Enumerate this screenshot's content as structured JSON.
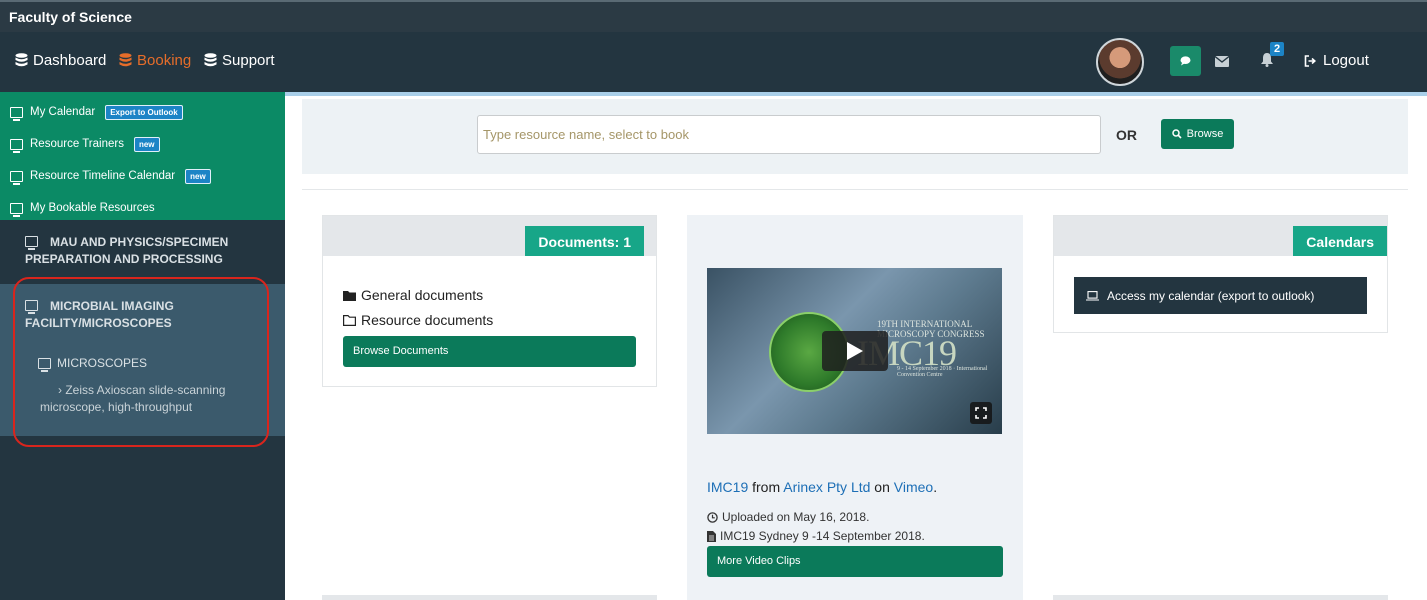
{
  "app_title": "Faculty of Science",
  "nav": {
    "dashboard": "Dashboard",
    "booking": "Booking",
    "support": "Support",
    "notification_count": "2",
    "logout": "Logout"
  },
  "sidebar": {
    "links": [
      {
        "label": "My Calendar",
        "tag": "Export to Outlook"
      },
      {
        "label": "Resource Trainers",
        "tag": "new"
      },
      {
        "label": "Resource Timeline Calendar",
        "tag": "new"
      },
      {
        "label": "My Bookable Resources",
        "tag": ""
      }
    ],
    "section1": "MAU AND PHYSICS/SPECIMEN PREPARATION AND PROCESSING",
    "section2": "MICROBIAL IMAGING FACILITY/MICROSCOPES",
    "subsection": "MICROSCOPES",
    "item": "Zeiss Axioscan slide-scanning microscope, high-throughput"
  },
  "search": {
    "placeholder": "Type resource name, select to book",
    "or_label": "OR",
    "browse_label": "Browse"
  },
  "documents": {
    "tag": "Documents: 1",
    "general": "General documents",
    "resource": "Resource documents",
    "browse_label": "Browse Documents"
  },
  "video": {
    "overlay_imc": "IMC19",
    "overlay_congress": "19TH INTERNATIONAL MICROSCOPY CONGRESS",
    "overlay_dates": "9 - 14 September 2018 · International Convention Centre",
    "title_link": "IMC19",
    "from": "from",
    "owner_link": "Arinex Pty Ltd",
    "on": "on",
    "site_link": "Vimeo",
    "period": ".",
    "uploaded": "Uploaded on May 16, 2018.",
    "description": "IMC19 Sydney 9 -14 September 2018.",
    "more_label": "More Video Clips"
  },
  "calendars": {
    "tag": "Calendars",
    "access_label": "Access my calendar (export to outlook)"
  },
  "colors": {
    "accent_green": "#0b7a5a",
    "teal_tag": "#17a688",
    "navbar": "#233540",
    "active_orange": "#e66d2a",
    "highlight_red": "#d9251d"
  }
}
